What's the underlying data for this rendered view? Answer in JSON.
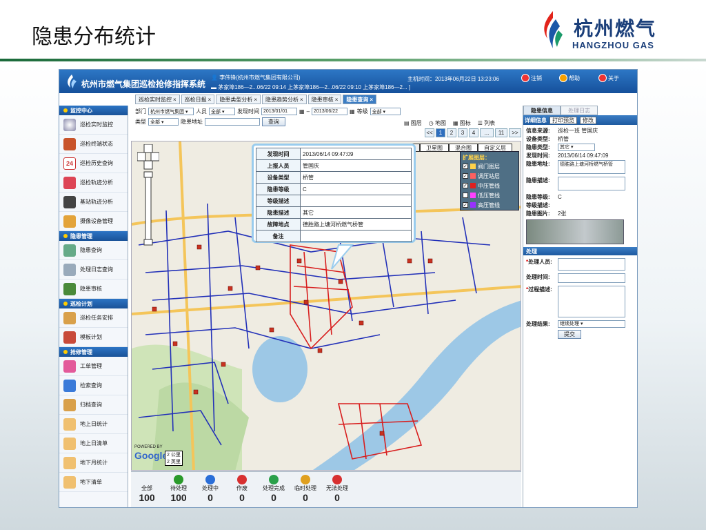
{
  "slide": {
    "title": "隐患分布统计",
    "logo_cn": "杭州燃气",
    "logo_en": "HANGZHOU GAS"
  },
  "app": {
    "title": "杭州市燃气集团巡检抢修指挥系统",
    "user": "李伟锋(杭州市燃气集团有限公司)",
    "notice": "茅家埠186—2...06/22 09:14 上茅家埠186—2...06/22 09:10 上茅家埠186—2... ]",
    "host_time": "主机时间：2013年06月22日 13:23:06",
    "buttons": {
      "logout": "注销",
      "help": "帮助",
      "about": "关于"
    }
  },
  "tabs": [
    {
      "label": "巡检实时监控"
    },
    {
      "label": "巡检日报"
    },
    {
      "label": "隐患类型分析"
    },
    {
      "label": "隐患趋势分析"
    },
    {
      "label": "隐患审核"
    },
    {
      "label": "隐患查询"
    }
  ],
  "sidebar": {
    "sections": [
      {
        "title": "监控中心",
        "items": [
          "巡检实时监控",
          "巡检终端状态",
          "巡检历史查询",
          "巡检轨迹分析",
          "基站轨迹分析",
          "摄像设备管理"
        ]
      },
      {
        "title": "隐患管理",
        "items": [
          "隐患查询",
          "处理日志查询",
          "隐患审核"
        ]
      },
      {
        "title": "巡检计划",
        "items": [
          "巡检任务安排",
          "模板计划"
        ]
      },
      {
        "title": "抢修管理",
        "items": [
          "工单管理",
          "检索查询",
          "归档查询",
          "地上日统计",
          "地上日清单",
          "地下月统计",
          "地下清单"
        ]
      }
    ]
  },
  "filters": {
    "dept_label": "部门",
    "dept_value": "杭州市燃气集团",
    "person_label": "人员",
    "person_value": "全部",
    "time_label": "发现时间",
    "date_from": "2013/01/01",
    "date_to": "2013/06/22",
    "level_label": "等级",
    "level_value": "全部",
    "type_label": "类型",
    "type_value": "全部",
    "address_label": "隐患地址",
    "address_value": "",
    "query_button": "查询"
  },
  "map_toolbar": {
    "layers": "图层",
    "map": "地图",
    "icons": "图标",
    "list": "列表"
  },
  "pager": {
    "prev": "<<",
    "pages": [
      "1",
      "2",
      "3",
      "4",
      "...",
      "11"
    ],
    "next": ">>",
    "current": "1"
  },
  "map_types": [
    "地图",
    "卫星图",
    "混合图",
    "自定义层"
  ],
  "popup": {
    "rows": [
      {
        "k": "发现时间",
        "v": "2013/06/14 09:47:09"
      },
      {
        "k": "上报人员",
        "v": "管国庆"
      },
      {
        "k": "设备类型",
        "v": "桥管"
      },
      {
        "k": "隐患等级",
        "v": "C"
      },
      {
        "k": "等级描述",
        "v": ""
      },
      {
        "k": "隐患描述",
        "v": "其它"
      },
      {
        "k": "故障地点",
        "v": "德胜路上塘河桥燃气桥管"
      },
      {
        "k": "备注",
        "v": ""
      }
    ]
  },
  "layers_panel": {
    "title": "扩展图层：",
    "items": [
      {
        "label": "阀门图层",
        "color": "#ffd24a"
      },
      {
        "label": "调压站层",
        "color": "#ff6060"
      },
      {
        "label": "中压管线",
        "color": "#e02020"
      },
      {
        "label": "低压管线",
        "color": "#ff40ff"
      },
      {
        "label": "高压管线",
        "color": "#9a30ff"
      }
    ]
  },
  "map_labels": {
    "google": "Google",
    "powered": "POWERED BY",
    "scale_top": "2 公里",
    "scale_bottom": "2 英里"
  },
  "status_counts": [
    {
      "label": "全部",
      "count": "100",
      "color": ""
    },
    {
      "label": "待处理",
      "count": "100",
      "color": "#2a9a2a"
    },
    {
      "label": "处理中",
      "count": "0",
      "color": "#2a6ed8"
    },
    {
      "label": "作废",
      "count": "0",
      "color": "#d83030"
    },
    {
      "label": "处理完成",
      "count": "0",
      "color": "#2aa04a"
    },
    {
      "label": "临时处理",
      "count": "0",
      "color": "#e0a020"
    },
    {
      "label": "无法处理",
      "count": "0",
      "color": "#d83030"
    }
  ],
  "right_panel": {
    "tabs": [
      "隐患信息",
      "处理日志"
    ],
    "bar_title": "详细信息",
    "print_btn": "打印预览",
    "edit_btn": "修改",
    "fields": [
      {
        "k": "信息来源:",
        "v": "巡检一班 管国庆"
      },
      {
        "k": "设备类型:",
        "v": "桥管"
      },
      {
        "k": "隐患类型:",
        "v": "其它"
      },
      {
        "k": "发现时间:",
        "v": "2013/06/14 09:47:09"
      },
      {
        "k": "隐患地址:",
        "v": "德胜路上塘河桥燃气桥管"
      },
      {
        "k": "隐患描述:",
        "v": ""
      },
      {
        "k": "隐患等级:",
        "v": "C"
      },
      {
        "k": "等级描述:",
        "v": ""
      },
      {
        "k": "隐患图片:",
        "v": "2张"
      }
    ],
    "process_title": "处理",
    "process_person": "处理人员:",
    "process_time": "处理时间:",
    "process_desc": "过程描述:",
    "process_result": "处理结果:",
    "result_value": "继续处理",
    "submit": "提交"
  }
}
